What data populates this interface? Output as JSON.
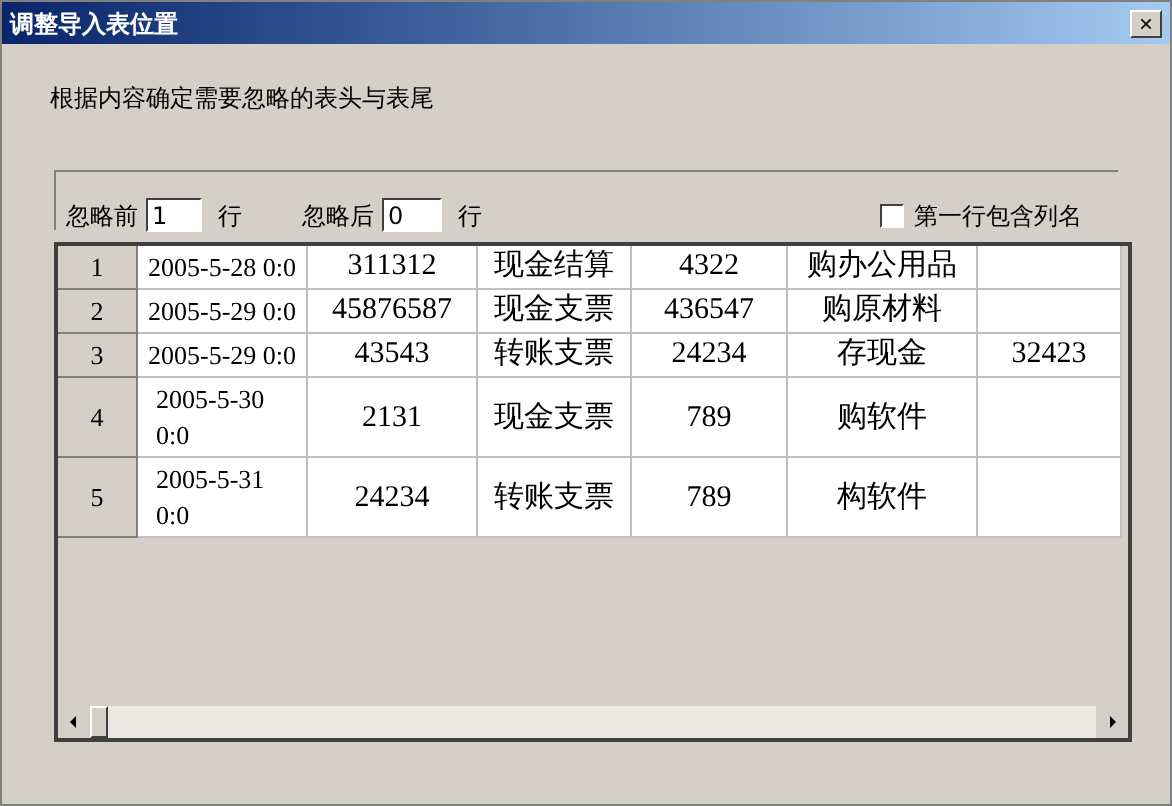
{
  "window": {
    "title": "调整导入表位置",
    "close": "×"
  },
  "instruction": "根据内容确定需要忽略的表头与表尾",
  "options": {
    "skip_before": {
      "label": "忽略前",
      "value": "1",
      "unit": "行"
    },
    "skip_after": {
      "label": "忽略后",
      "value": "0",
      "unit": "行"
    },
    "header_row": {
      "label": "第一行包含列名",
      "checked": false
    }
  },
  "table": {
    "rows": [
      {
        "number": "1",
        "wrapped": false,
        "cells": [
          "2005-5-28 0:0",
          "311312",
          "现金结算",
          "4322",
          "购办公用品",
          ""
        ]
      },
      {
        "number": "2",
        "wrapped": false,
        "cells": [
          "2005-5-29 0:0",
          "45876587",
          "现金支票",
          "436547",
          "购原材料",
          ""
        ]
      },
      {
        "number": "3",
        "wrapped": false,
        "cells": [
          "2005-5-29 0:0",
          "43543",
          "转账支票",
          "24234",
          "存现金",
          "32423"
        ]
      },
      {
        "number": "4",
        "wrapped": true,
        "cells": [
          "2005-5-30 0:0",
          "2131",
          "现金支票",
          "789",
          "购软件",
          ""
        ]
      },
      {
        "number": "5",
        "wrapped": true,
        "cells": [
          "2005-5-31 0:0",
          "24234",
          "转账支票",
          "789",
          "构软件",
          ""
        ]
      }
    ]
  }
}
